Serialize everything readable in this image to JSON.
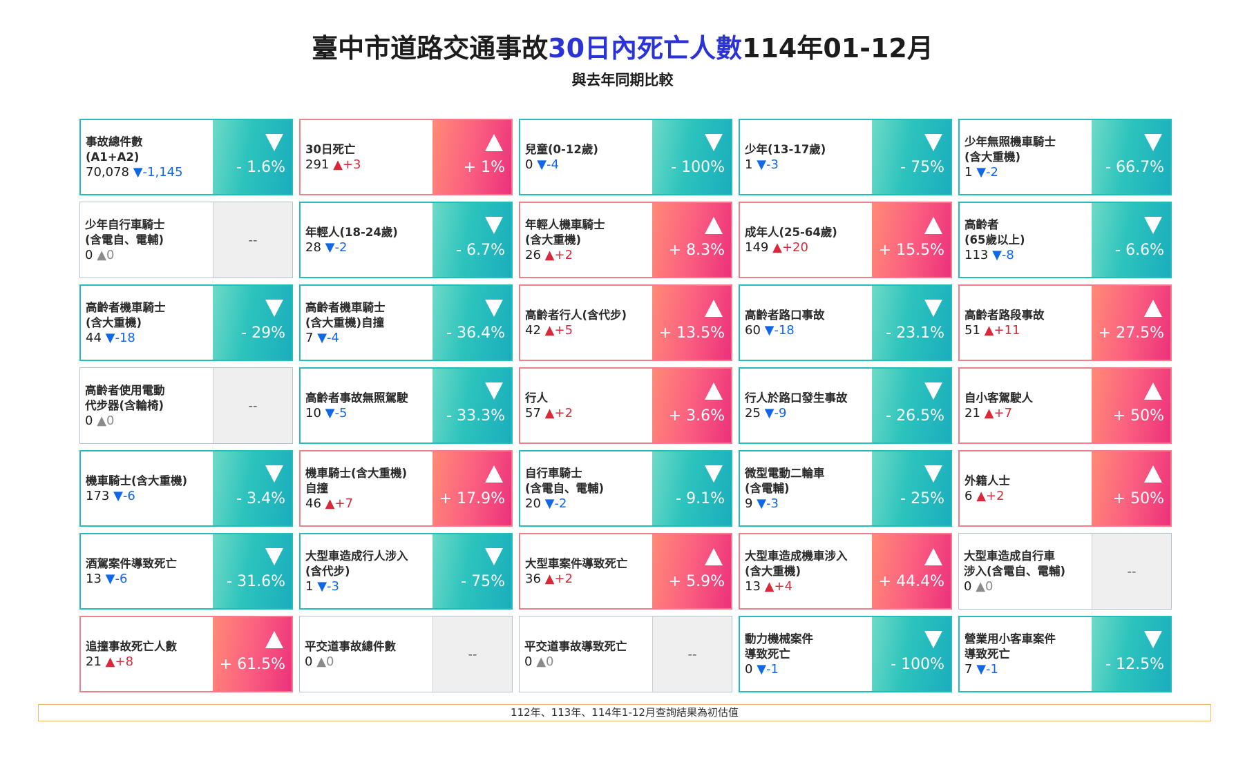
{
  "header": {
    "title_part1": "臺中市道路交通事故",
    "title_highlight": "30日內死亡人數",
    "title_part2": "114年01-12月",
    "subtitle": "與去年同期比較"
  },
  "colors": {
    "decrease": "#25bdbb",
    "increase": "#f25b7a",
    "no_change": "#efefef",
    "decrease_text": "#1267e6",
    "increase_text": "#d8293a",
    "title_highlight": "#2b32d6"
  },
  "cards": [
    {
      "label": "事故總件數\n(A1+A2)",
      "value": "70,078",
      "delta": "▼-1,145",
      "pct": "- 1.6%",
      "trend": "down"
    },
    {
      "label": "30日死亡",
      "value": "291",
      "delta": "▲+3",
      "pct": "+ 1%",
      "trend": "up"
    },
    {
      "label": "兒童(0-12歲)",
      "value": "0",
      "delta": "▼-4",
      "pct": "- 100%",
      "trend": "down"
    },
    {
      "label": "少年(13-17歲)",
      "value": "1",
      "delta": "▼-3",
      "pct": "- 75%",
      "trend": "down"
    },
    {
      "label": "少年無照機車騎士\n(含大重機)",
      "value": "1",
      "delta": "▼-2",
      "pct": "- 66.7%",
      "trend": "down"
    },
    {
      "label": "少年自行車騎士\n(含電自、電輔)",
      "value": "0",
      "delta": "▲0",
      "pct": "--",
      "trend": "none"
    },
    {
      "label": "年輕人(18-24歲)",
      "value": "28",
      "delta": "▼-2",
      "pct": "- 6.7%",
      "trend": "down"
    },
    {
      "label": "年輕人機車騎士\n(含大重機)",
      "value": "26",
      "delta": "▲+2",
      "pct": "+ 8.3%",
      "trend": "up"
    },
    {
      "label": "成年人(25-64歲)",
      "value": "149",
      "delta": "▲+20",
      "pct": "+ 15.5%",
      "trend": "up"
    },
    {
      "label": "高齡者\n(65歲以上)",
      "value": "113",
      "delta": "▼-8",
      "pct": "- 6.6%",
      "trend": "down"
    },
    {
      "label": "高齡者機車騎士\n(含大重機)",
      "value": "44",
      "delta": "▼-18",
      "pct": "- 29%",
      "trend": "down"
    },
    {
      "label": "高齡者機車騎士\n(含大重機)自撞",
      "value": "7",
      "delta": "▼-4",
      "pct": "- 36.4%",
      "trend": "down"
    },
    {
      "label": "高齡者行人(含代步)",
      "value": "42",
      "delta": "▲+5",
      "pct": "+ 13.5%",
      "trend": "up"
    },
    {
      "label": "高齡者路口事故",
      "value": "60",
      "delta": "▼-18",
      "pct": "- 23.1%",
      "trend": "down"
    },
    {
      "label": "高齡者路段事故",
      "value": "51",
      "delta": "▲+11",
      "pct": "+ 27.5%",
      "trend": "up"
    },
    {
      "label": "高齡者使用電動\n代步器(含輪椅)",
      "value": "0",
      "delta": "▲0",
      "pct": "--",
      "trend": "none"
    },
    {
      "label": "高齡者事故無照駕駛",
      "value": "10",
      "delta": "▼-5",
      "pct": "- 33.3%",
      "trend": "down"
    },
    {
      "label": "行人",
      "value": "57",
      "delta": "▲+2",
      "pct": "+ 3.6%",
      "trend": "up"
    },
    {
      "label": "行人於路口發生事故",
      "value": "25",
      "delta": "▼-9",
      "pct": "- 26.5%",
      "trend": "down"
    },
    {
      "label": "自小客駕駛人",
      "value": "21",
      "delta": "▲+7",
      "pct": "+ 50%",
      "trend": "up"
    },
    {
      "label": "機車騎士(含大重機)",
      "value": "173",
      "delta": "▼-6",
      "pct": "- 3.4%",
      "trend": "down"
    },
    {
      "label": "機車騎士(含大重機)\n自撞",
      "value": "46",
      "delta": "▲+7",
      "pct": "+ 17.9%",
      "trend": "up"
    },
    {
      "label": "自行車騎士\n(含電自、電輔)",
      "value": "20",
      "delta": "▼-2",
      "pct": "- 9.1%",
      "trend": "down"
    },
    {
      "label": "微型電動二輪車\n(含電輔)",
      "value": "9",
      "delta": "▼-3",
      "pct": "- 25%",
      "trend": "down"
    },
    {
      "label": "外籍人士",
      "value": "6",
      "delta": "▲+2",
      "pct": "+ 50%",
      "trend": "up"
    },
    {
      "label": "酒駕案件導致死亡",
      "value": "13",
      "delta": "▼-6",
      "pct": "- 31.6%",
      "trend": "down"
    },
    {
      "label": "大型車造成行人涉入\n(含代步)",
      "value": "1",
      "delta": "▼-3",
      "pct": "- 75%",
      "trend": "down"
    },
    {
      "label": "大型車案件導致死亡",
      "value": "36",
      "delta": "▲+2",
      "pct": "+ 5.9%",
      "trend": "up"
    },
    {
      "label": "大型車造成機車涉入\n(含大重機)",
      "value": "13",
      "delta": "▲+4",
      "pct": "+ 44.4%",
      "trend": "up"
    },
    {
      "label": "大型車造成自行車\n涉入(含電自、電輔)",
      "value": "0",
      "delta": "▲0",
      "pct": "--",
      "trend": "none"
    },
    {
      "label": "追撞事故死亡人數",
      "value": "21",
      "delta": "▲+8",
      "pct": "+ 61.5%",
      "trend": "up"
    },
    {
      "label": "平交道事故總件數",
      "value": "0",
      "delta": "▲0",
      "pct": "--",
      "trend": "none"
    },
    {
      "label": "平交道事故導致死亡",
      "value": "0",
      "delta": "▲0",
      "pct": "--",
      "trend": "none"
    },
    {
      "label": "動力機械案件\n導致死亡",
      "value": "0",
      "delta": "▼-1",
      "pct": "- 100%",
      "trend": "down"
    },
    {
      "label": "營業用小客車案件\n導致死亡",
      "value": "7",
      "delta": "▼-1",
      "pct": "- 12.5%",
      "trend": "down"
    }
  ],
  "footnote": "112年、113年、114年1-12月查詢結果為初估值"
}
